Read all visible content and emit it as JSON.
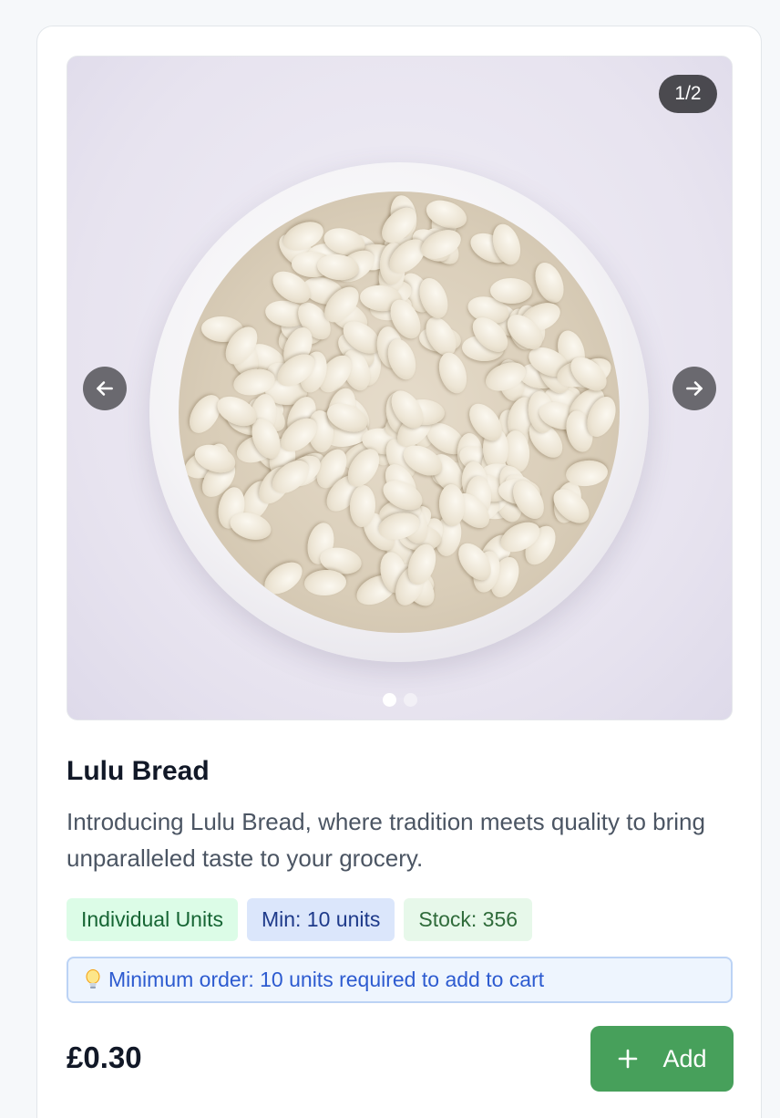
{
  "product": {
    "name": "Lulu Bread",
    "description": "Introducing Lulu Bread, where tradition meets quality to bring unparalleled taste to your grocery.",
    "price": "£0.30",
    "image_alt": "Bowl of white beans"
  },
  "gallery": {
    "counter": "1/2",
    "current_index": 1,
    "total": 2,
    "prev_icon": "arrow-left-icon",
    "next_icon": "arrow-right-icon"
  },
  "tags": {
    "units": "Individual Units",
    "minimum": "Min: 10 units",
    "stock": "Stock: 356"
  },
  "notice": {
    "icon": "lightbulb-icon",
    "text": "Minimum order: 10 units required to add to cart"
  },
  "actions": {
    "add_label": "Add",
    "add_icon": "plus-icon"
  },
  "colors": {
    "accent_green": "#47a05b",
    "notice_blue": "#2d5bd0",
    "title": "#111827"
  }
}
